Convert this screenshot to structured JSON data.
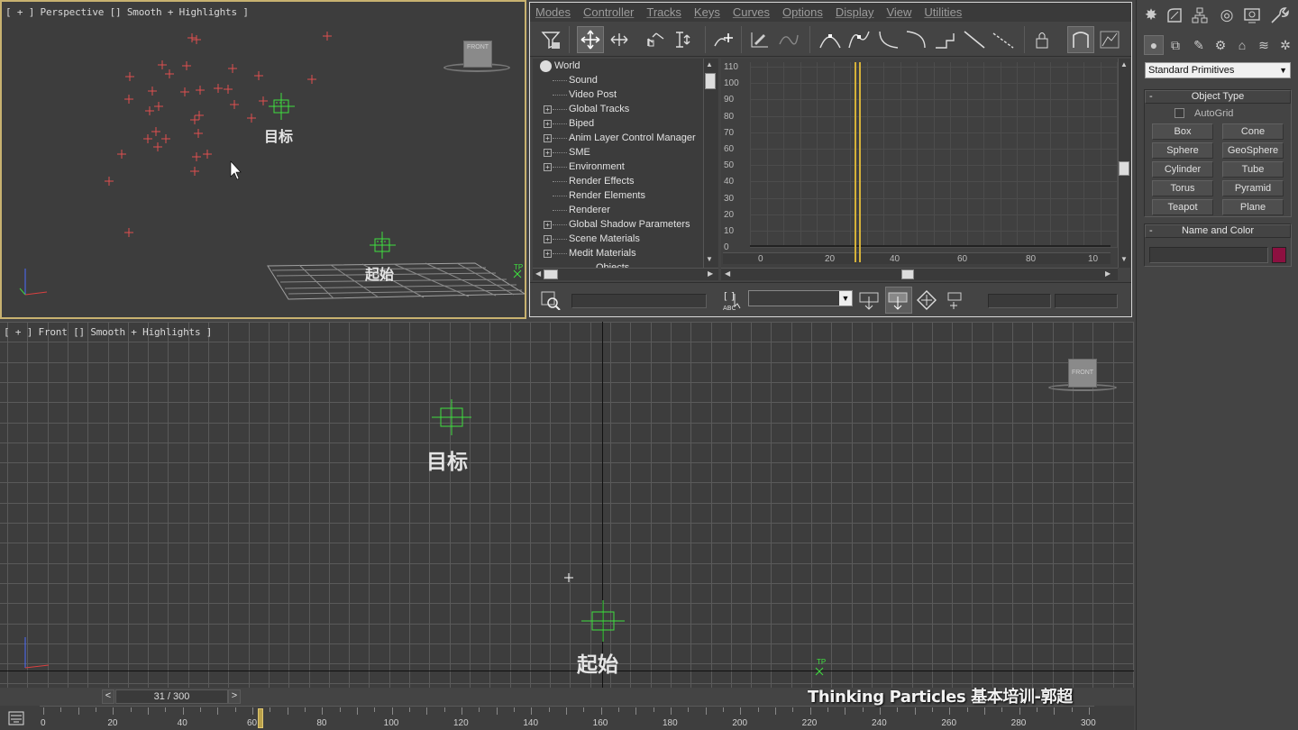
{
  "viewport_top": {
    "label": "[ + ] Perspective [] Smooth + Highlights ]",
    "target_label": "目标",
    "start_label": "起始",
    "cube_label": "FRONT",
    "tp_label": "TP"
  },
  "viewport_front": {
    "label": "[ + ] Front [] Smooth + Highlights ]",
    "target_label": "目标",
    "start_label": "起始",
    "cube_label": "FRONT",
    "tp_label": "TP"
  },
  "trackview": {
    "menu": [
      "Modes",
      "Controller",
      "Tracks",
      "Keys",
      "Curves",
      "Options",
      "Display",
      "View",
      "Utilities"
    ],
    "tree": [
      {
        "label": "World",
        "indent": 0,
        "expander": ""
      },
      {
        "label": "Sound",
        "indent": 1,
        "expander": ""
      },
      {
        "label": "Video Post",
        "indent": 1,
        "expander": ""
      },
      {
        "label": "Global Tracks",
        "indent": 1,
        "expander": "+"
      },
      {
        "label": "Biped",
        "indent": 1,
        "expander": "+"
      },
      {
        "label": "Anim Layer Control Manager",
        "indent": 1,
        "expander": "+"
      },
      {
        "label": "SME",
        "indent": 1,
        "expander": "+"
      },
      {
        "label": "Environment",
        "indent": 1,
        "expander": "+"
      },
      {
        "label": "Render Effects",
        "indent": 1,
        "expander": ""
      },
      {
        "label": "Render Elements",
        "indent": 1,
        "expander": ""
      },
      {
        "label": "Renderer",
        "indent": 1,
        "expander": ""
      },
      {
        "label": "Global Shadow Parameters",
        "indent": 1,
        "expander": "+"
      },
      {
        "label": "Scene Materials",
        "indent": 1,
        "expander": "+"
      },
      {
        "label": "Medit Materials",
        "indent": 1,
        "expander": "+"
      },
      {
        "label": "Objects",
        "indent": 2,
        "expander": ""
      }
    ],
    "y_ticks": [
      "110",
      "100",
      "90",
      "80",
      "70",
      "60",
      "50",
      "40",
      "30",
      "20",
      "10",
      "0"
    ],
    "x_ticks": [
      "0",
      "20",
      "40",
      "60",
      "80",
      "10"
    ],
    "current_frame_line_color": "#d4b13a"
  },
  "command_panel": {
    "category": "Standard Primitives",
    "object_type_title": "Object Type",
    "autogrid_label": "AutoGrid",
    "primitives": [
      "Box",
      "Cone",
      "Sphere",
      "GeoSphere",
      "Cylinder",
      "Tube",
      "Torus",
      "Pyramid",
      "Teapot",
      "Plane"
    ],
    "name_color_title": "Name and Color",
    "object_color": "#8c1040"
  },
  "timeslider": {
    "frame_text": "31 / 300",
    "prev": "<",
    "next": ">",
    "current_frame": 31,
    "total_frames": 300
  },
  "trackbar": {
    "ticks": [
      "0",
      "20",
      "40",
      "60",
      "80",
      "100",
      "120",
      "140",
      "160",
      "180",
      "200",
      "220",
      "240",
      "260",
      "280",
      "300"
    ]
  },
  "subtitle": "Thinking Particles 基本培训-郭超",
  "colors": {
    "accent_green": "#3fe03f",
    "particle_red": "#e05050",
    "active_border": "#c8b270"
  }
}
